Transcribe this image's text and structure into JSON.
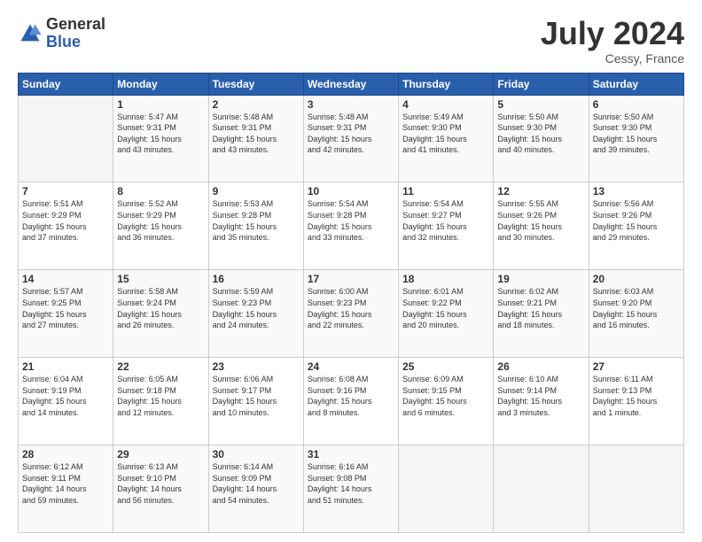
{
  "logo": {
    "general": "General",
    "blue": "Blue"
  },
  "title": "July 2024",
  "location": "Cessy, France",
  "weekdays": [
    "Sunday",
    "Monday",
    "Tuesday",
    "Wednesday",
    "Thursday",
    "Friday",
    "Saturday"
  ],
  "weeks": [
    [
      {
        "day": "",
        "info": ""
      },
      {
        "day": "1",
        "info": "Sunrise: 5:47 AM\nSunset: 9:31 PM\nDaylight: 15 hours\nand 43 minutes."
      },
      {
        "day": "2",
        "info": "Sunrise: 5:48 AM\nSunset: 9:31 PM\nDaylight: 15 hours\nand 43 minutes."
      },
      {
        "day": "3",
        "info": "Sunrise: 5:48 AM\nSunset: 9:31 PM\nDaylight: 15 hours\nand 42 minutes."
      },
      {
        "day": "4",
        "info": "Sunrise: 5:49 AM\nSunset: 9:30 PM\nDaylight: 15 hours\nand 41 minutes."
      },
      {
        "day": "5",
        "info": "Sunrise: 5:50 AM\nSunset: 9:30 PM\nDaylight: 15 hours\nand 40 minutes."
      },
      {
        "day": "6",
        "info": "Sunrise: 5:50 AM\nSunset: 9:30 PM\nDaylight: 15 hours\nand 39 minutes."
      }
    ],
    [
      {
        "day": "7",
        "info": "Sunrise: 5:51 AM\nSunset: 9:29 PM\nDaylight: 15 hours\nand 37 minutes."
      },
      {
        "day": "8",
        "info": "Sunrise: 5:52 AM\nSunset: 9:29 PM\nDaylight: 15 hours\nand 36 minutes."
      },
      {
        "day": "9",
        "info": "Sunrise: 5:53 AM\nSunset: 9:28 PM\nDaylight: 15 hours\nand 35 minutes."
      },
      {
        "day": "10",
        "info": "Sunrise: 5:54 AM\nSunset: 9:28 PM\nDaylight: 15 hours\nand 33 minutes."
      },
      {
        "day": "11",
        "info": "Sunrise: 5:54 AM\nSunset: 9:27 PM\nDaylight: 15 hours\nand 32 minutes."
      },
      {
        "day": "12",
        "info": "Sunrise: 5:55 AM\nSunset: 9:26 PM\nDaylight: 15 hours\nand 30 minutes."
      },
      {
        "day": "13",
        "info": "Sunrise: 5:56 AM\nSunset: 9:26 PM\nDaylight: 15 hours\nand 29 minutes."
      }
    ],
    [
      {
        "day": "14",
        "info": "Sunrise: 5:57 AM\nSunset: 9:25 PM\nDaylight: 15 hours\nand 27 minutes."
      },
      {
        "day": "15",
        "info": "Sunrise: 5:58 AM\nSunset: 9:24 PM\nDaylight: 15 hours\nand 26 minutes."
      },
      {
        "day": "16",
        "info": "Sunrise: 5:59 AM\nSunset: 9:23 PM\nDaylight: 15 hours\nand 24 minutes."
      },
      {
        "day": "17",
        "info": "Sunrise: 6:00 AM\nSunset: 9:23 PM\nDaylight: 15 hours\nand 22 minutes."
      },
      {
        "day": "18",
        "info": "Sunrise: 6:01 AM\nSunset: 9:22 PM\nDaylight: 15 hours\nand 20 minutes."
      },
      {
        "day": "19",
        "info": "Sunrise: 6:02 AM\nSunset: 9:21 PM\nDaylight: 15 hours\nand 18 minutes."
      },
      {
        "day": "20",
        "info": "Sunrise: 6:03 AM\nSunset: 9:20 PM\nDaylight: 15 hours\nand 16 minutes."
      }
    ],
    [
      {
        "day": "21",
        "info": "Sunrise: 6:04 AM\nSunset: 9:19 PM\nDaylight: 15 hours\nand 14 minutes."
      },
      {
        "day": "22",
        "info": "Sunrise: 6:05 AM\nSunset: 9:18 PM\nDaylight: 15 hours\nand 12 minutes."
      },
      {
        "day": "23",
        "info": "Sunrise: 6:06 AM\nSunset: 9:17 PM\nDaylight: 15 hours\nand 10 minutes."
      },
      {
        "day": "24",
        "info": "Sunrise: 6:08 AM\nSunset: 9:16 PM\nDaylight: 15 hours\nand 8 minutes."
      },
      {
        "day": "25",
        "info": "Sunrise: 6:09 AM\nSunset: 9:15 PM\nDaylight: 15 hours\nand 6 minutes."
      },
      {
        "day": "26",
        "info": "Sunrise: 6:10 AM\nSunset: 9:14 PM\nDaylight: 15 hours\nand 3 minutes."
      },
      {
        "day": "27",
        "info": "Sunrise: 6:11 AM\nSunset: 9:13 PM\nDaylight: 15 hours\nand 1 minute."
      }
    ],
    [
      {
        "day": "28",
        "info": "Sunrise: 6:12 AM\nSunset: 9:11 PM\nDaylight: 14 hours\nand 59 minutes."
      },
      {
        "day": "29",
        "info": "Sunrise: 6:13 AM\nSunset: 9:10 PM\nDaylight: 14 hours\nand 56 minutes."
      },
      {
        "day": "30",
        "info": "Sunrise: 6:14 AM\nSunset: 9:09 PM\nDaylight: 14 hours\nand 54 minutes."
      },
      {
        "day": "31",
        "info": "Sunrise: 6:16 AM\nSunset: 9:08 PM\nDaylight: 14 hours\nand 51 minutes."
      },
      {
        "day": "",
        "info": ""
      },
      {
        "day": "",
        "info": ""
      },
      {
        "day": "",
        "info": ""
      }
    ]
  ]
}
